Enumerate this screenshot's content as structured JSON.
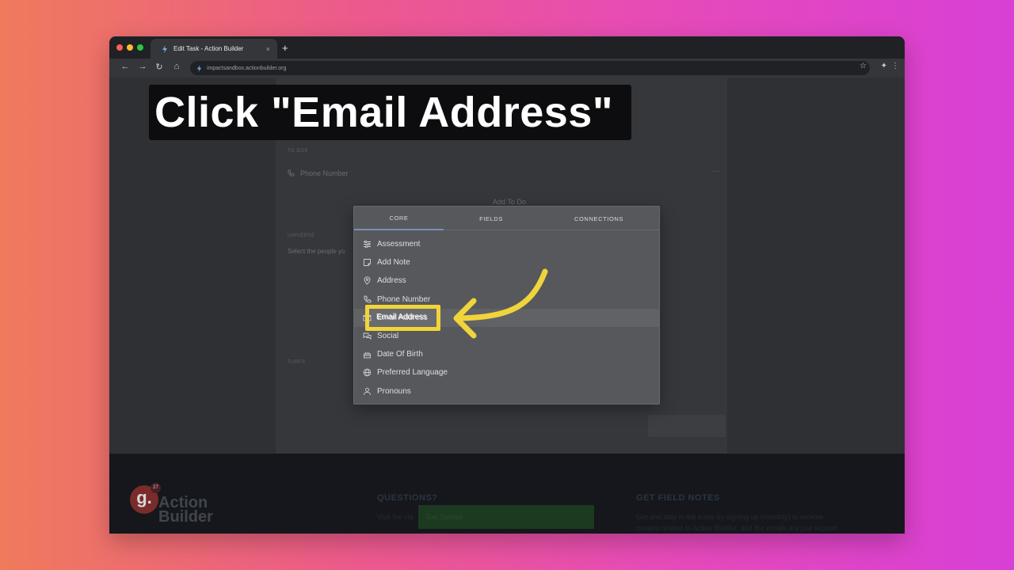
{
  "browser": {
    "tab_title": "Edit Task - Action Builder",
    "tab_close": "×",
    "new_tab": "+",
    "url": "impactsandbox.actionbuilder.org"
  },
  "caption": "Click \"Email Address\"",
  "background_page": {
    "section_todo": "TO DOS",
    "phone_number": "Phone Number",
    "add_todo": "Add To Do",
    "section_universe": "UNIVERSE",
    "universe_text": "Select the people yo",
    "section_turfs": "TURFS"
  },
  "modal": {
    "tabs": [
      {
        "label": "CORE",
        "active": true
      },
      {
        "label": "FIELDS",
        "active": false
      },
      {
        "label": "CONNECTIONS",
        "active": false
      }
    ],
    "items": [
      {
        "label": "Assessment",
        "icon": "sliders-icon"
      },
      {
        "label": "Add Note",
        "icon": "note-icon"
      },
      {
        "label": "Address",
        "icon": "map-pin-icon"
      },
      {
        "label": "Phone Number",
        "icon": "phone-icon"
      },
      {
        "label": "Email Address",
        "icon": "mail-icon"
      },
      {
        "label": "Social",
        "icon": "chat-icon"
      },
      {
        "label": "Date Of Birth",
        "icon": "cake-icon"
      },
      {
        "label": "Preferred Language",
        "icon": "globe-icon"
      },
      {
        "label": "Pronouns",
        "icon": "person-icon"
      }
    ]
  },
  "footer": {
    "questions_heading": "QUESTIONS?",
    "questions_text": "Visit the He",
    "button_label": "Get Started",
    "field_notes_heading": "GET FIELD NOTES",
    "field_notes_line1": "Get and stay in the know by signing up (monthly) to receive",
    "field_notes_line2": "content related to Action Builder, and the emails are just support",
    "logo_text_line1": "Action",
    "logo_text_line2": "Builder",
    "logo_letter": "g.",
    "logo_badge": "27"
  },
  "colors": {
    "highlight": "#f1d43a",
    "arrow": "#f1d43a",
    "active_tab_underline": "#7b8fb6"
  }
}
